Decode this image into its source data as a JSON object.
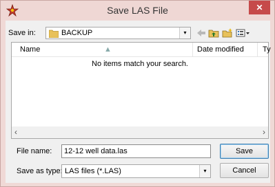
{
  "window": {
    "title": "Save LAS File",
    "close_label": "✕"
  },
  "toolbar": {
    "save_in_label": "Save in:",
    "current_folder": "BACKUP",
    "dropdown_arrow": "▾",
    "icons": [
      "back-arrow-icon",
      "up-folder-icon",
      "new-folder-icon",
      "view-menu-icon"
    ]
  },
  "file_list": {
    "columns": [
      "Name",
      "Date modified",
      "Ty"
    ],
    "empty_message": "No items match your search.",
    "scroll_left": "‹",
    "scroll_right": "›"
  },
  "form": {
    "file_name_label": "File name:",
    "file_name_value": "12-12 well data.las",
    "save_as_type_label": "Save as type:",
    "save_as_type_value": "LAS files (*.LAS)",
    "save_button": "Save",
    "cancel_button": "Cancel"
  },
  "colors": {
    "title_bg": "#efd7d4",
    "close_bg": "#c64a4a",
    "folder_yellow": "#e8c15a"
  }
}
